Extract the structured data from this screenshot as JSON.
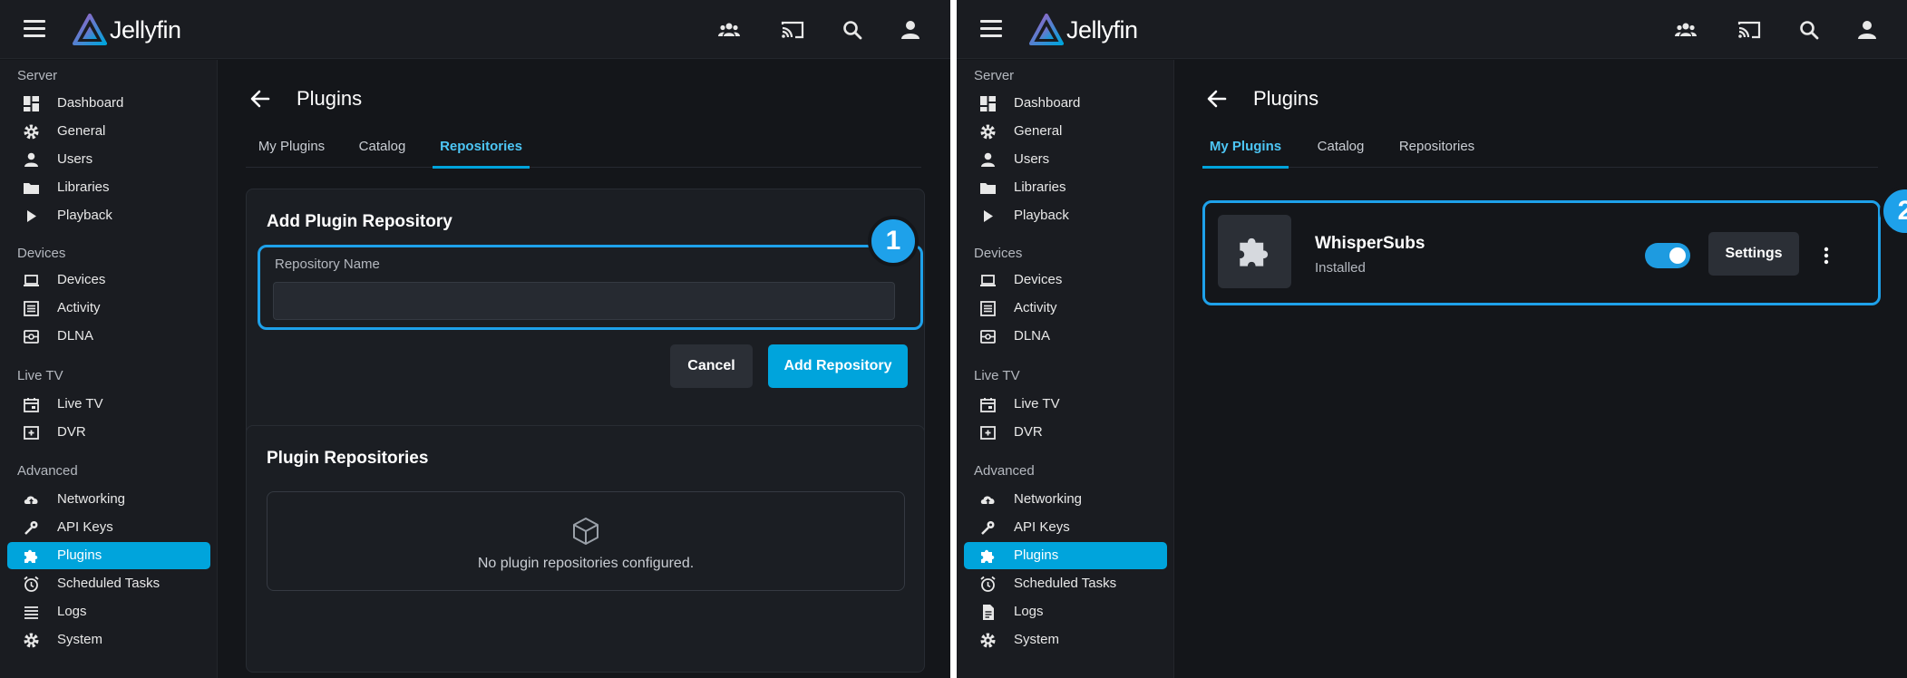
{
  "app": {
    "name": "Jellyfin",
    "accent_color": "#00a4dc",
    "top_icons": [
      "users-icon",
      "cast-icon",
      "search-icon",
      "user-icon"
    ]
  },
  "sidebar": {
    "sections": {
      "server": "Server",
      "devices": "Devices",
      "livetv": "Live TV",
      "advanced": "Advanced"
    },
    "items": {
      "dashboard": "Dashboard",
      "general": "General",
      "users": "Users",
      "libraries": "Libraries",
      "playback": "Playback",
      "devices": "Devices",
      "activity": "Activity",
      "dlna": "DLNA",
      "livetv": "Live TV",
      "dvr": "DVR",
      "networking": "Networking",
      "apikeys": "API Keys",
      "plugins": "Plugins",
      "scheduled": "Scheduled Tasks",
      "logs": "Logs",
      "system": "System"
    },
    "active": "Plugins"
  },
  "page": {
    "title": "Plugins",
    "tabs": {
      "my_plugins": "My Plugins",
      "catalog": "Catalog",
      "repositories": "Repositories"
    }
  },
  "left": {
    "active_tab": "Repositories",
    "badge": "1",
    "add_repo": {
      "title": "Add Plugin Repository",
      "field_label": "Repository Name",
      "field_value": "",
      "cancel_label": "Cancel",
      "submit_label": "Add Repository"
    },
    "repos": {
      "title": "Plugin Repositories",
      "empty_text": "No plugin repositories configured."
    }
  },
  "right": {
    "active_tab": "My Plugins",
    "badge": "2",
    "plugin": {
      "name": "WhisperSubs",
      "status": "Installed",
      "enabled": true,
      "settings_label": "Settings"
    }
  }
}
